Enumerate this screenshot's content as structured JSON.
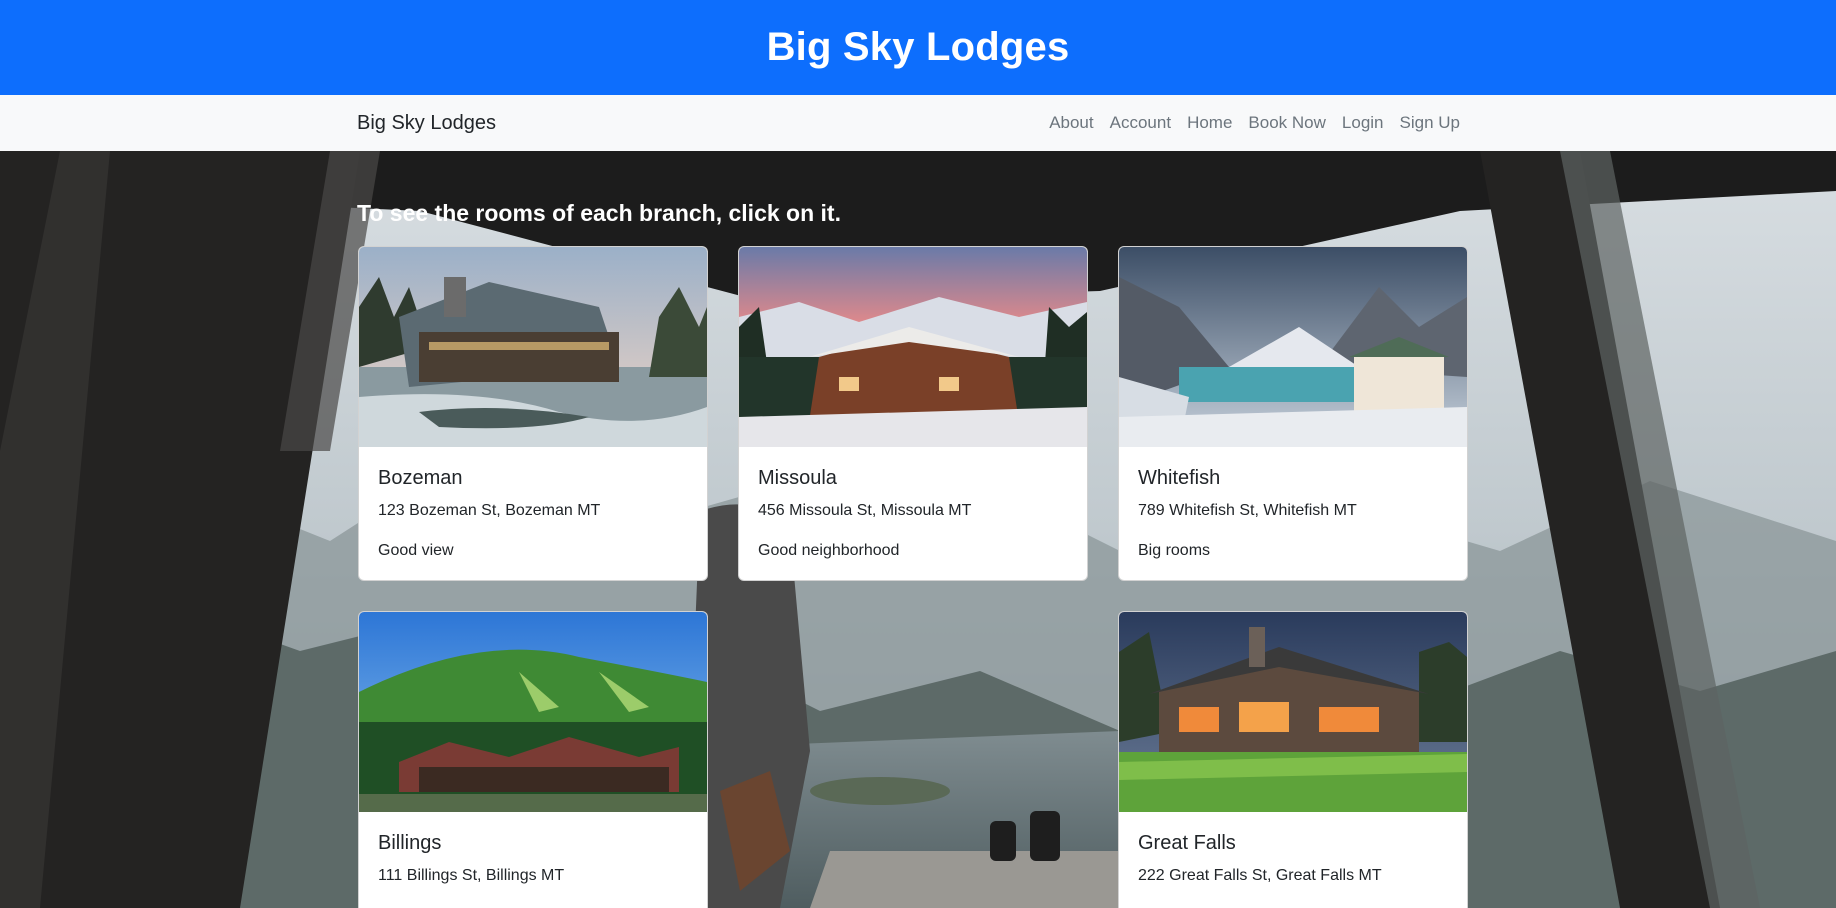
{
  "banner": {
    "title": "Big Sky Lodges"
  },
  "navbar": {
    "brand": "Big Sky Lodges",
    "links": [
      "About",
      "Account",
      "Home",
      "Book Now",
      "Login",
      "Sign Up"
    ]
  },
  "main": {
    "intro": "To see the rooms of each branch, click on it.",
    "cards": [
      {
        "name": "Bozeman",
        "address": "123 Bozeman St, Bozeman MT",
        "feature": "Good view"
      },
      {
        "name": "Missoula",
        "address": "456 Missoula St, Missoula MT",
        "feature": "Good neighborhood"
      },
      {
        "name": "Whitefish",
        "address": "789 Whitefish St, Whitefish MT",
        "feature": "Big rooms"
      },
      {
        "name": "Billings",
        "address": "111 Billings St, Billings MT",
        "feature": ""
      },
      {
        "name": "Great Falls",
        "address": "222 Great Falls St, Great Falls MT",
        "feature": ""
      }
    ]
  },
  "colors": {
    "banner": "#0d6efd",
    "navbar": "#f8f9fa",
    "nav_link": "#6c757d"
  }
}
